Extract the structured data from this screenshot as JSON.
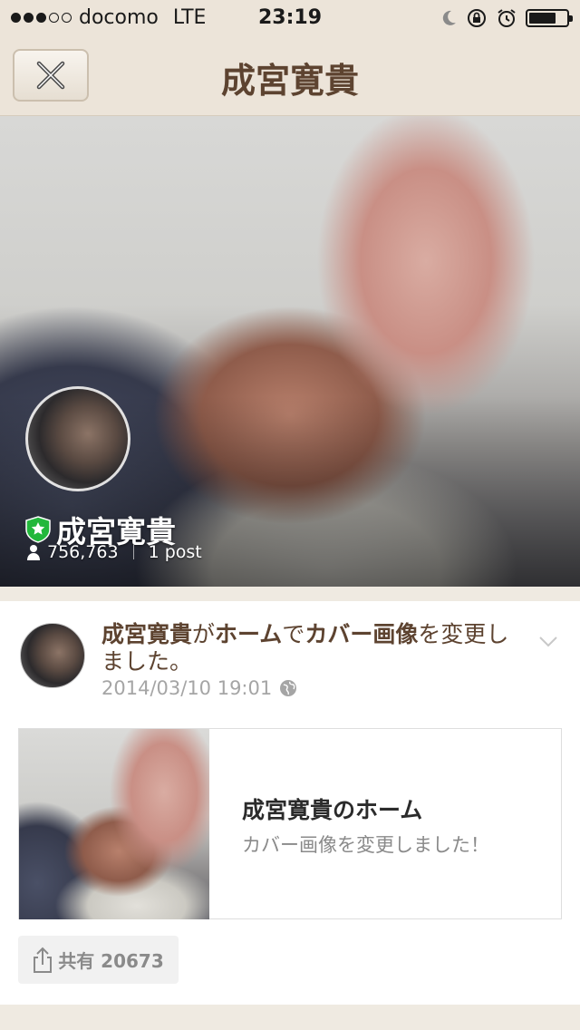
{
  "status_bar": {
    "carrier": "docomo",
    "network": "LTE",
    "time": "23:19",
    "signal_filled": 3,
    "signal_total": 5,
    "battery_level": 0.72
  },
  "nav": {
    "title": "成宮寛貴",
    "close_icon": "close-x-icon"
  },
  "profile": {
    "name": "成宮寛貴",
    "followers": "756,763",
    "posts": "1 post",
    "badge_color": "#22b73b"
  },
  "post": {
    "text_parts": [
      "成宮寛貴",
      "が",
      "ホーム",
      "で",
      "カバー画像",
      "を変更しました。"
    ],
    "timestamp": "2014/03/10 19:01",
    "link_title": "成宮寛貴のホーム",
    "link_description": "カバー画像を変更しました！",
    "share_label": "共有 20673"
  },
  "colors": {
    "brand_brown": "#5d4330",
    "nav_bg": "#ece4d9",
    "page_bg": "#efeae1"
  }
}
